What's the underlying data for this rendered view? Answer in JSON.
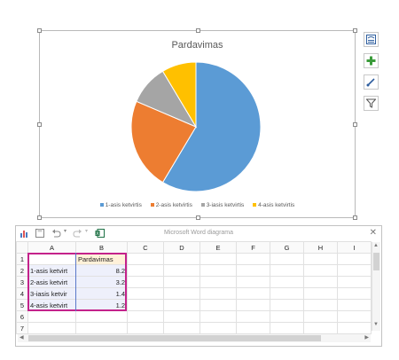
{
  "chart": {
    "title": "Pardavimas",
    "legend": [
      {
        "label": "1-asis ketvirtis",
        "color": "#5b9bd5"
      },
      {
        "label": "2-asis ketvirtis",
        "color": "#ed7d31"
      },
      {
        "label": "3-iasis ketvirtis",
        "color": "#a5a5a5"
      },
      {
        "label": "4-asis ketvirtis",
        "color": "#ffc000"
      }
    ]
  },
  "chart_data": {
    "type": "pie",
    "title": "Pardavimas",
    "categories": [
      "1-asis ketvirtis",
      "2-asis ketvirtis",
      "3-iasis ketvirtis",
      "4-asis ketvirtis"
    ],
    "values": [
      8.2,
      3.2,
      1.4,
      1.2
    ],
    "colors": [
      "#5b9bd5",
      "#ed7d31",
      "#a5a5a5",
      "#ffc000"
    ],
    "legend_position": "bottom"
  },
  "side_tools": [
    "layout-options-icon",
    "chart-elements-icon",
    "chart-styles-icon",
    "chart-filters-icon"
  ],
  "sheet": {
    "title": "Microsoft Word diagrama",
    "close": "✕",
    "columns": [
      "A",
      "B",
      "C",
      "D",
      "E",
      "F",
      "G",
      "H",
      "I"
    ],
    "rows": [
      "1",
      "2",
      "3",
      "4",
      "5",
      "6",
      "7"
    ],
    "cells": [
      [
        "",
        "Pardavimas"
      ],
      [
        "1-asis ketvirt",
        "8.2"
      ],
      [
        "2-asis ketvirt",
        "3.2"
      ],
      [
        "3-iasis ketvir",
        "1.4"
      ],
      [
        "4-asis ketvirt",
        "1.2"
      ],
      [
        "",
        ""
      ],
      [
        "",
        ""
      ]
    ]
  }
}
